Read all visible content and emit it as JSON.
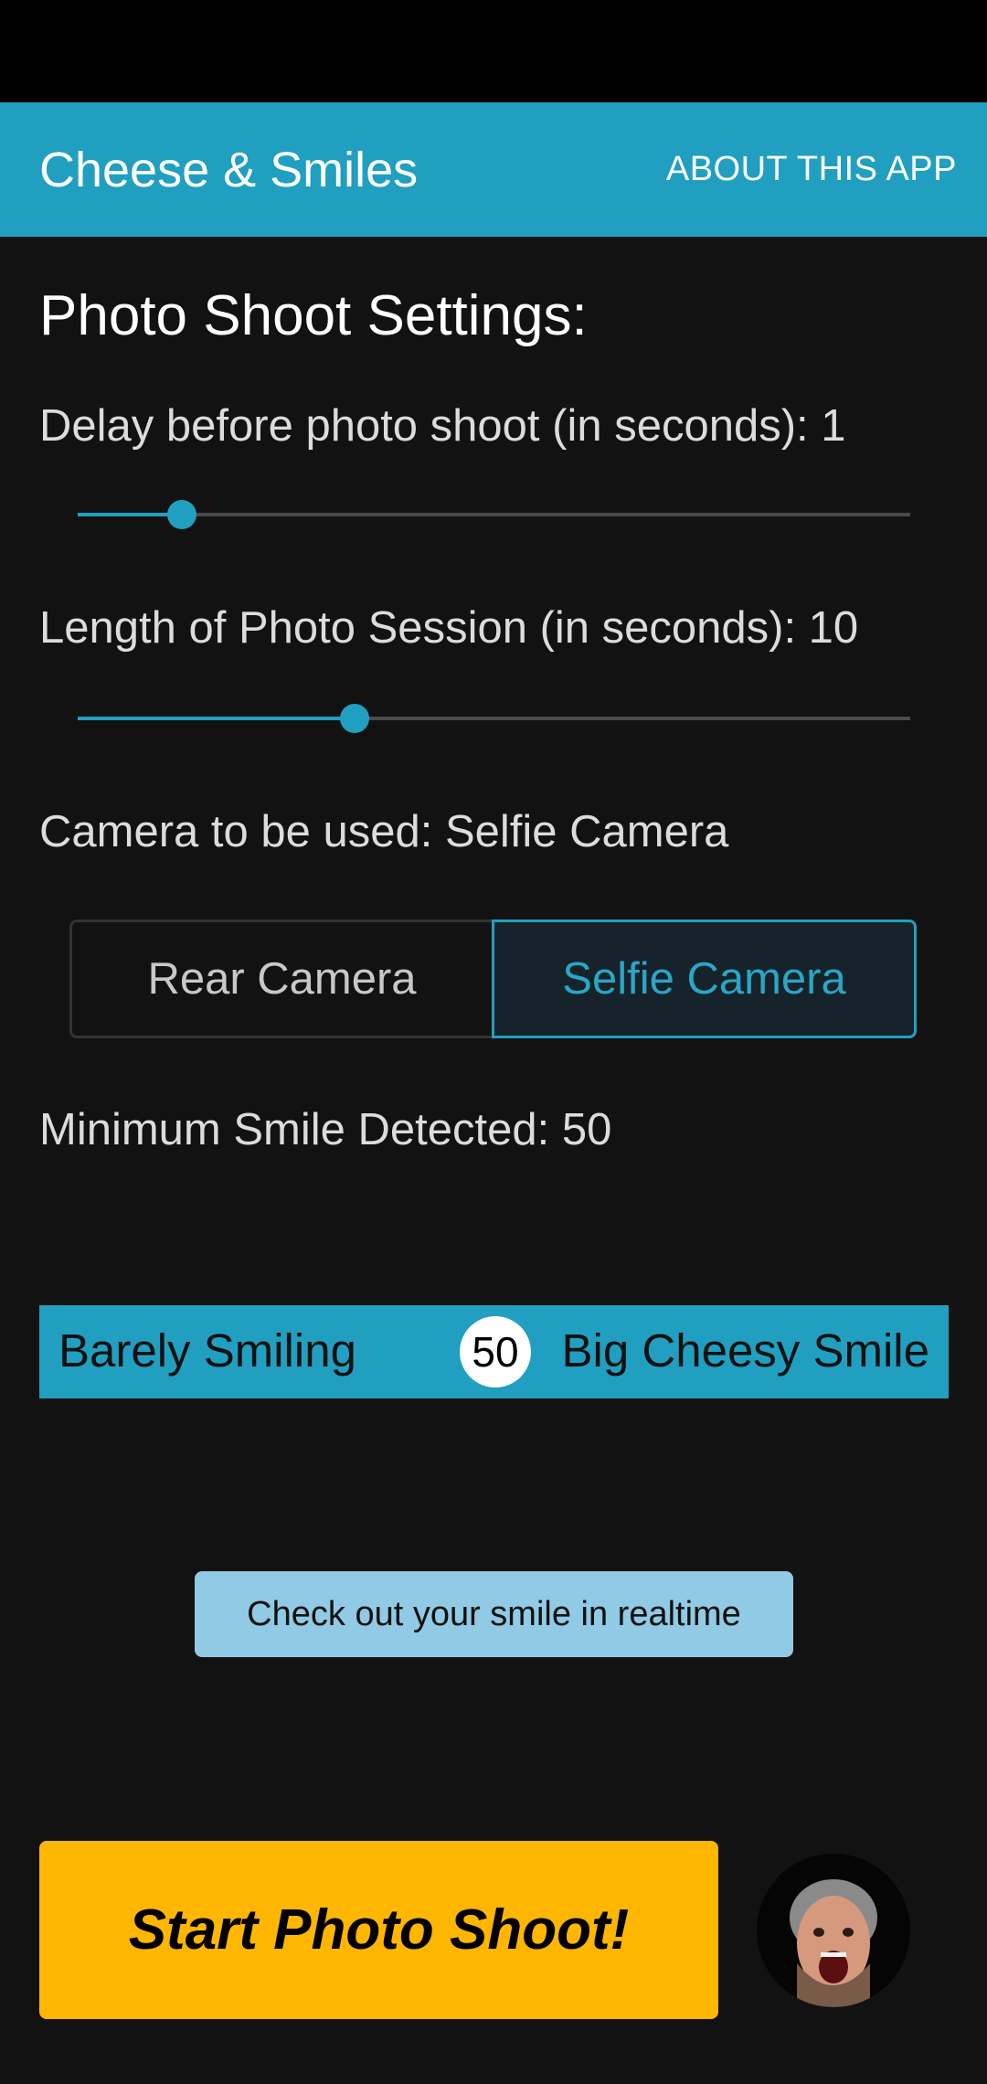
{
  "app_bar": {
    "title": "Cheese & Smiles",
    "about_label": "ABOUT THIS APP"
  },
  "settings": {
    "heading": "Photo Shoot Settings:",
    "delay": {
      "label": "Delay before photo shoot (in seconds): 1",
      "value_fraction": 0.125
    },
    "length": {
      "label": "Length of Photo Session (in seconds): 10",
      "value_fraction": 0.333
    },
    "camera": {
      "label": "Camera to be used: Selfie Camera",
      "options": [
        "Rear Camera",
        "Selfie Camera"
      ],
      "selected": "Selfie Camera"
    },
    "min_smile": {
      "label": "Minimum Smile Detected: 50",
      "low_label": "Barely Smiling",
      "high_label": "Big Cheesy Smile",
      "value": "50"
    }
  },
  "realtime_button_label": "Check out your smile in realtime",
  "start_button_label": "Start Photo Shoot!",
  "colors": {
    "accent": "#219fc0",
    "start_button": "#ffb600",
    "realtime_button": "#90cae4",
    "background": "#121212"
  }
}
